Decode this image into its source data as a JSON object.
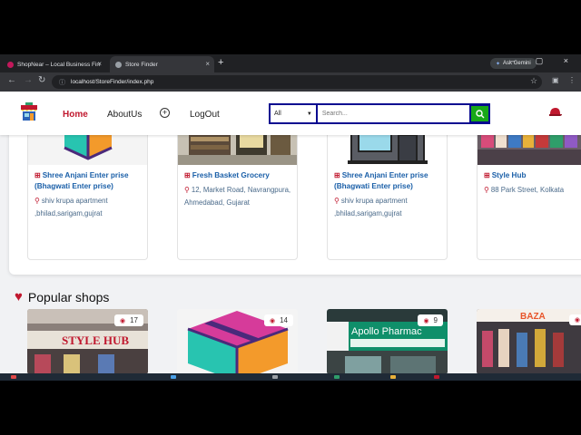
{
  "browser": {
    "tabs": [
      {
        "title": "ShopNear – Local Business Fin",
        "close": "×"
      },
      {
        "title": "Store Finder",
        "close": "×"
      }
    ],
    "new_tab": "+",
    "gemini_label": "Ask Gemini",
    "url": "localhost/StoreFinder/index.php",
    "window_controls": "–  ▢  ×"
  },
  "header": {
    "nav": {
      "home": "Home",
      "about": "AboutUs",
      "add": "+",
      "logout": "LogOut"
    },
    "search": {
      "category": "All",
      "placeholder": "Search..."
    }
  },
  "stores": [
    {
      "name": "Shree Anjani Enter prise (Bhagwati Enter prise)",
      "address": "shiv krupa apartment ,bhilad,sarigam,gujrat",
      "image": "box-icon"
    },
    {
      "name": "Fresh Basket Grocery",
      "address": "12, Market Road, Navrangpura, Ahmedabad, Gujarat",
      "image": "grocery-photo"
    },
    {
      "name": "Shree Anjani Enter prise (Bhagwati Enter prise)",
      "address": "shiv krupa apartment ,bhilad,sarigam,gujrat",
      "image": "shop-icon"
    },
    {
      "name": "Style Hub",
      "address": "88 Park Street, Kolkata",
      "image": "fashion-photo"
    }
  ],
  "popular": {
    "heading": "Popular shops",
    "shops": [
      {
        "views": "17",
        "image": "style-hub-photo",
        "sign": "STYLE HUB"
      },
      {
        "views": "14",
        "image": "box-icon"
      },
      {
        "views": "9",
        "image": "apollo-pharmacy-photo",
        "sign": "Apollo Pharmac"
      },
      {
        "views": "",
        "image": "bazaar-photo",
        "sign": "BAZA"
      }
    ]
  },
  "colors": {
    "accent": "#c0182e",
    "link": "#1a5fa8",
    "search_border": "#0a0a90",
    "search_button": "#18a818"
  }
}
